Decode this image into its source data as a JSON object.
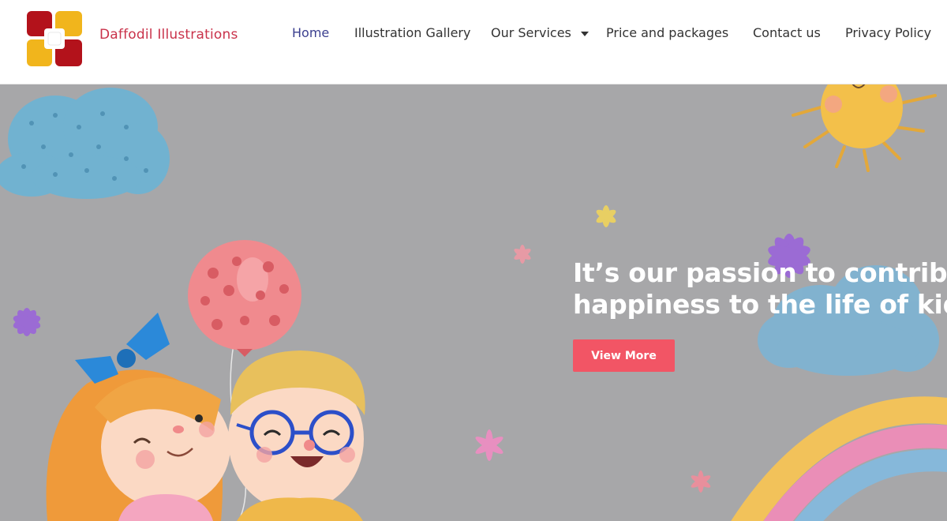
{
  "brand": {
    "name": "Daffodil Illustrations"
  },
  "nav": {
    "items": [
      {
        "label": "Home",
        "active": true
      },
      {
        "label": "Illustration Gallery"
      },
      {
        "label": "Our Services",
        "has_dropdown": true
      },
      {
        "label": "Price and packages"
      },
      {
        "label": "Contact us"
      },
      {
        "label": "Privacy Policy"
      }
    ]
  },
  "hero": {
    "headline_line1": "It’s our passion to contribut",
    "headline_line2": "happiness to the life of kids.",
    "cta_label": "View More"
  },
  "colors": {
    "brand_text": "#c9324a",
    "active_nav": "#3b3f8f",
    "hero_bg": "#a7a7a9",
    "cta_bg": "#f25565"
  },
  "icons": {
    "logo": "four-squares-logo-icon",
    "dropdown": "chevron-down-icon"
  }
}
